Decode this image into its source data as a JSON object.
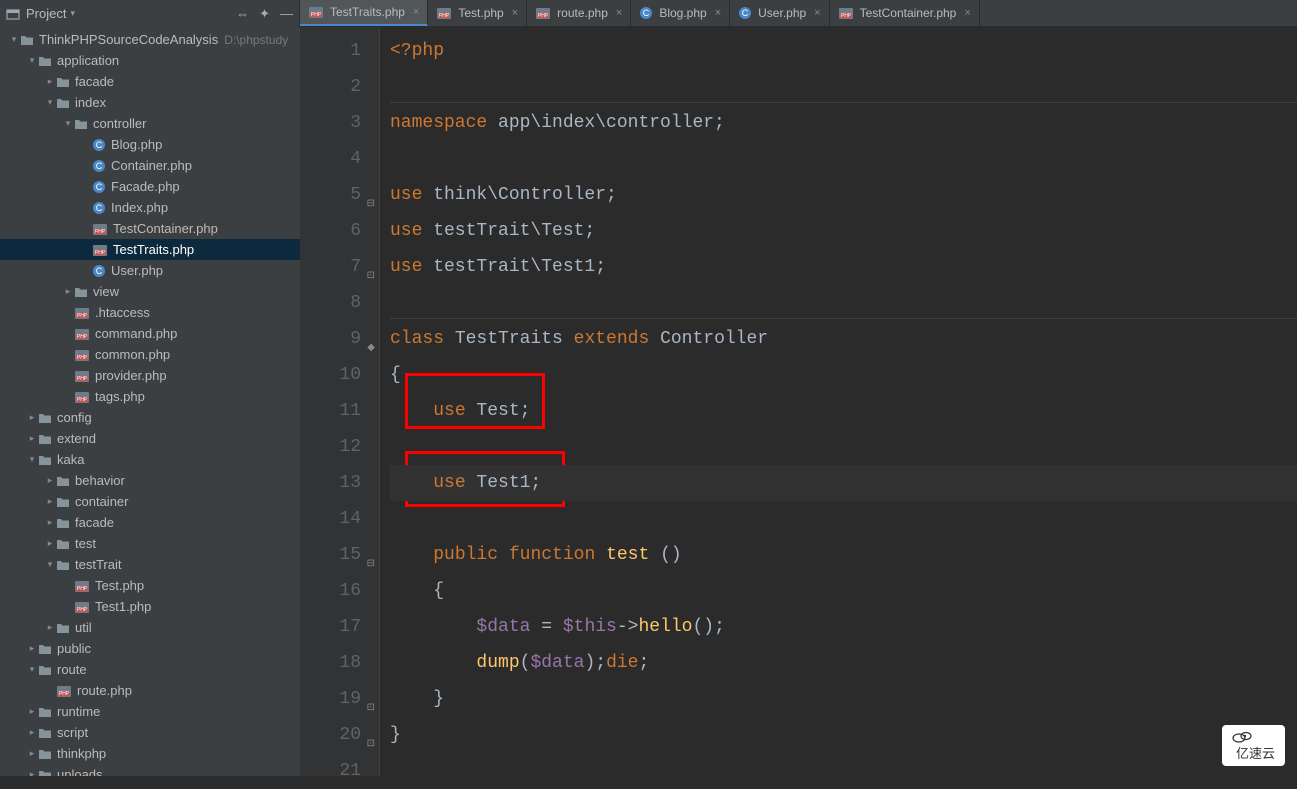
{
  "header": {
    "project_label": "Project",
    "icons": {
      "settings": "✦",
      "collapse": "⇔",
      "hide": "—"
    }
  },
  "tabs": [
    {
      "label": "TestTraits.php",
      "icon": "php",
      "active": true
    },
    {
      "label": "Test.php",
      "icon": "php",
      "active": false
    },
    {
      "label": "route.php",
      "icon": "php",
      "active": false
    },
    {
      "label": "Blog.php",
      "icon": "class",
      "active": false
    },
    {
      "label": "User.php",
      "icon": "class",
      "active": false
    },
    {
      "label": "TestContainer.php",
      "icon": "php",
      "active": false
    }
  ],
  "tree": [
    {
      "depth": 0,
      "arrow": "down",
      "icon": "folder",
      "label": "ThinkPHPSourceCodeAnalysis",
      "path": "D:\\phpstudy"
    },
    {
      "depth": 1,
      "arrow": "down",
      "icon": "folder",
      "label": "application"
    },
    {
      "depth": 2,
      "arrow": "right",
      "icon": "folder",
      "label": "facade"
    },
    {
      "depth": 2,
      "arrow": "down",
      "icon": "folder",
      "label": "index"
    },
    {
      "depth": 3,
      "arrow": "down",
      "icon": "folder",
      "label": "controller"
    },
    {
      "depth": 4,
      "arrow": "none",
      "icon": "class",
      "label": "Blog.php"
    },
    {
      "depth": 4,
      "arrow": "none",
      "icon": "class",
      "label": "Container.php"
    },
    {
      "depth": 4,
      "arrow": "none",
      "icon": "class",
      "label": "Facade.php"
    },
    {
      "depth": 4,
      "arrow": "none",
      "icon": "class",
      "label": "Index.php"
    },
    {
      "depth": 4,
      "arrow": "none",
      "icon": "php",
      "label": "TestContainer.php"
    },
    {
      "depth": 4,
      "arrow": "none",
      "icon": "php",
      "label": "TestTraits.php",
      "selected": true
    },
    {
      "depth": 4,
      "arrow": "none",
      "icon": "class",
      "label": "User.php"
    },
    {
      "depth": 3,
      "arrow": "right",
      "icon": "folder",
      "label": "view"
    },
    {
      "depth": 3,
      "arrow": "none",
      "icon": "php",
      "label": ".htaccess"
    },
    {
      "depth": 3,
      "arrow": "none",
      "icon": "php",
      "label": "command.php"
    },
    {
      "depth": 3,
      "arrow": "none",
      "icon": "php",
      "label": "common.php"
    },
    {
      "depth": 3,
      "arrow": "none",
      "icon": "php",
      "label": "provider.php"
    },
    {
      "depth": 3,
      "arrow": "none",
      "icon": "php",
      "label": "tags.php"
    },
    {
      "depth": 1,
      "arrow": "right",
      "icon": "folder",
      "label": "config"
    },
    {
      "depth": 1,
      "arrow": "right",
      "icon": "folder",
      "label": "extend"
    },
    {
      "depth": 1,
      "arrow": "down",
      "icon": "folder",
      "label": "kaka"
    },
    {
      "depth": 2,
      "arrow": "right",
      "icon": "folder",
      "label": "behavior"
    },
    {
      "depth": 2,
      "arrow": "right",
      "icon": "folder",
      "label": "container"
    },
    {
      "depth": 2,
      "arrow": "right",
      "icon": "folder",
      "label": "facade"
    },
    {
      "depth": 2,
      "arrow": "right",
      "icon": "folder",
      "label": "test"
    },
    {
      "depth": 2,
      "arrow": "down",
      "icon": "folder",
      "label": "testTrait"
    },
    {
      "depth": 3,
      "arrow": "none",
      "icon": "php",
      "label": "Test.php"
    },
    {
      "depth": 3,
      "arrow": "none",
      "icon": "php",
      "label": "Test1.php"
    },
    {
      "depth": 2,
      "arrow": "right",
      "icon": "folder",
      "label": "util"
    },
    {
      "depth": 1,
      "arrow": "right",
      "icon": "folder",
      "label": "public"
    },
    {
      "depth": 1,
      "arrow": "down",
      "icon": "folder",
      "label": "route"
    },
    {
      "depth": 2,
      "arrow": "none",
      "icon": "php",
      "label": "route.php"
    },
    {
      "depth": 1,
      "arrow": "right",
      "icon": "folder",
      "label": "runtime"
    },
    {
      "depth": 1,
      "arrow": "right",
      "icon": "folder",
      "label": "script"
    },
    {
      "depth": 1,
      "arrow": "right",
      "icon": "folder",
      "label": "thinkphp"
    },
    {
      "depth": 1,
      "arrow": "right",
      "icon": "folder",
      "label": "uploads"
    }
  ],
  "code": {
    "lines": [
      {
        "n": 1,
        "tokens": [
          {
            "t": "<?php",
            "c": "kw"
          }
        ]
      },
      {
        "n": 2,
        "tokens": [],
        "hr": true
      },
      {
        "n": 3,
        "tokens": [
          {
            "t": "namespace",
            "c": "kw"
          },
          {
            "t": " app\\index\\controller;",
            "c": "plain"
          }
        ]
      },
      {
        "n": 4,
        "tokens": []
      },
      {
        "n": 5,
        "fold": "open",
        "tokens": [
          {
            "t": "use",
            "c": "kw"
          },
          {
            "t": " think\\Controller;",
            "c": "plain"
          }
        ]
      },
      {
        "n": 6,
        "tokens": [
          {
            "t": "use",
            "c": "kw"
          },
          {
            "t": " testTrait\\Test;",
            "c": "plain"
          }
        ]
      },
      {
        "n": 7,
        "fold": "close",
        "tokens": [
          {
            "t": "use",
            "c": "kw"
          },
          {
            "t": " testTrait\\Test1;",
            "c": "plain"
          }
        ]
      },
      {
        "n": 8,
        "tokens": [],
        "hr": true
      },
      {
        "n": 9,
        "fold": "cls",
        "tokens": [
          {
            "t": "class",
            "c": "kw"
          },
          {
            "t": " TestTraits ",
            "c": "cls"
          },
          {
            "t": "extends",
            "c": "kw"
          },
          {
            "t": " Controller",
            "c": "cls"
          }
        ]
      },
      {
        "n": 10,
        "tokens": [
          {
            "t": "{",
            "c": "plain"
          }
        ]
      },
      {
        "n": 11,
        "tokens": [
          {
            "t": "    ",
            "c": "plain"
          },
          {
            "t": "use",
            "c": "kw"
          },
          {
            "t": " Test;",
            "c": "plain"
          }
        ]
      },
      {
        "n": 12,
        "tokens": []
      },
      {
        "n": 13,
        "cur": true,
        "tokens": [
          {
            "t": "    ",
            "c": "plain"
          },
          {
            "t": "use",
            "c": "kw"
          },
          {
            "t": " Test1;",
            "c": "plain"
          }
        ]
      },
      {
        "n": 14,
        "tokens": []
      },
      {
        "n": 15,
        "fold": "open",
        "tokens": [
          {
            "t": "    ",
            "c": "plain"
          },
          {
            "t": "public",
            "c": "kw"
          },
          {
            "t": " ",
            "c": "plain"
          },
          {
            "t": "function",
            "c": "kw"
          },
          {
            "t": " ",
            "c": "plain"
          },
          {
            "t": "test",
            "c": "fn"
          },
          {
            "t": " ()",
            "c": "plain"
          }
        ]
      },
      {
        "n": 16,
        "tokens": [
          {
            "t": "    {",
            "c": "plain"
          }
        ]
      },
      {
        "n": 17,
        "tokens": [
          {
            "t": "        ",
            "c": "plain"
          },
          {
            "t": "$data",
            "c": "var"
          },
          {
            "t": " = ",
            "c": "plain"
          },
          {
            "t": "$this",
            "c": "var"
          },
          {
            "t": "->",
            "c": "plain"
          },
          {
            "t": "hello",
            "c": "fn"
          },
          {
            "t": "();",
            "c": "plain"
          }
        ]
      },
      {
        "n": 18,
        "tokens": [
          {
            "t": "        ",
            "c": "plain"
          },
          {
            "t": "dump",
            "c": "fn"
          },
          {
            "t": "(",
            "c": "plain"
          },
          {
            "t": "$data",
            "c": "var"
          },
          {
            "t": ");",
            "c": "plain"
          },
          {
            "t": "die",
            "c": "kw"
          },
          {
            "t": ";",
            "c": "plain"
          }
        ]
      },
      {
        "n": 19,
        "fold": "close",
        "tokens": [
          {
            "t": "    }",
            "c": "plain"
          }
        ]
      },
      {
        "n": 20,
        "fold": "close",
        "tokens": [
          {
            "t": "}",
            "c": "plain"
          }
        ]
      },
      {
        "n": 21,
        "tokens": []
      }
    ]
  },
  "watermark": "亿速云"
}
